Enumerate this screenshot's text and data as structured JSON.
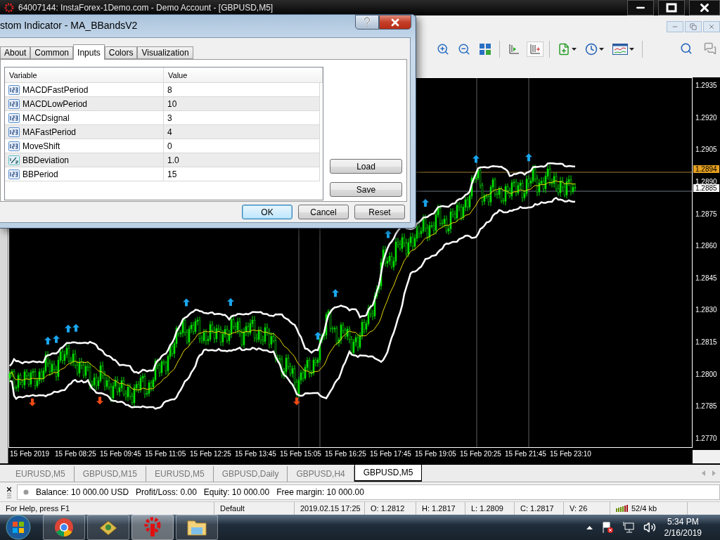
{
  "window": {
    "title": "64007144: InstaForex-1Demo.com - Demo Account - [GBPUSD,M5]"
  },
  "dialog": {
    "title": "stom Indicator - MA_BBandsV2",
    "tabs": [
      {
        "label": "About",
        "selected": false
      },
      {
        "label": "Common",
        "selected": false
      },
      {
        "label": "Inputs",
        "selected": true
      },
      {
        "label": "Colors",
        "selected": false
      },
      {
        "label": "Visualization",
        "selected": false
      }
    ],
    "columns": [
      "Variable",
      "Value"
    ],
    "rows": [
      {
        "kind": "integer",
        "variable": "MACDFastPeriod",
        "value": "8"
      },
      {
        "kind": "integer",
        "variable": "MACDLowPeriod",
        "value": "10"
      },
      {
        "kind": "integer",
        "variable": "MACDsignal",
        "value": "3"
      },
      {
        "kind": "integer",
        "variable": "MAFastPeriod",
        "value": "4"
      },
      {
        "kind": "integer",
        "variable": "MoveShift",
        "value": "0"
      },
      {
        "kind": "double",
        "variable": "BBDeviation",
        "value": "1.0"
      },
      {
        "kind": "integer",
        "variable": "BBPeriod",
        "value": "15"
      }
    ],
    "side_buttons": [
      "Load",
      "Save"
    ],
    "buttons": [
      {
        "label": "OK",
        "default": true
      },
      {
        "label": "Cancel",
        "default": false
      },
      {
        "label": "Reset",
        "default": false
      }
    ]
  },
  "chart": {
    "price_axis": [
      "1.2935",
      "1.2920",
      "1.2905",
      "1.2890",
      "1.2875",
      "1.2860",
      "1.2845",
      "1.2830",
      "1.2815",
      "1.2800",
      "1.2785",
      "1.2770"
    ],
    "price_markers": [
      {
        "kind": "bid",
        "label": "1.2894"
      },
      {
        "kind": "ask",
        "label": "1.2885"
      }
    ],
    "time_axis": [
      "15 Feb 2019",
      "15 Feb 08:25",
      "15 Feb 09:45",
      "15 Feb 11:05",
      "15 Feb 12:25",
      "15 Feb 13:45",
      "15 Feb 15:05",
      "15 Feb 16:25",
      "15 Feb 17:45",
      "15 Feb 19:05",
      "15 Feb 20:25",
      "15 Feb 21:45",
      "15 Feb 23:10"
    ]
  },
  "chart_tabs": [
    {
      "label": "EURUSD,M5",
      "selected": false
    },
    {
      "label": "GBPUSD,M15",
      "selected": false
    },
    {
      "label": "EURUSD,M5",
      "selected": false
    },
    {
      "label": "GBPUSD,Daily",
      "selected": false
    },
    {
      "label": "GBPUSD,H4",
      "selected": false
    },
    {
      "label": "GBPUSD,M5",
      "selected": true
    }
  ],
  "terminal": {
    "items": [
      "Balance: 10 000.00 USD",
      "Profit/Loss: 0.00",
      "Equity: 10 000.00",
      "Free margin: 10 000.00"
    ]
  },
  "status_bar": [
    "For Help, press F1",
    "Default",
    "2019.02.15 17:25",
    "O: 1.2812",
    "H: 1.2817",
    "L: 1.2809",
    "C: 1.2817",
    "V: 26",
    "52/4 kb"
  ],
  "taskbar": {
    "time": "5:34 PM",
    "date": "2/16/2019"
  }
}
